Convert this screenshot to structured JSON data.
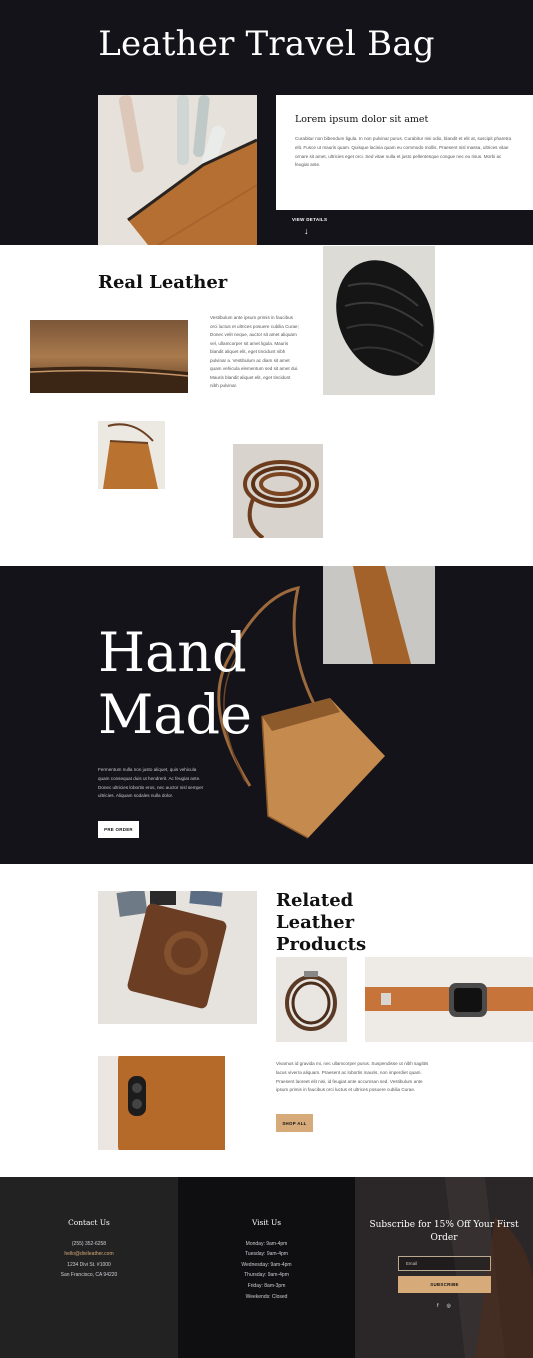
{
  "hero": {
    "title": "Leather Travel Bag",
    "card_heading": "Lorem ipsum dolor sit amet",
    "card_text": "Curabitur non bibendum ligula. In non pulvinar purus. Curabitur nisi odio, blandit et elit at, suscipit pharetra elit. Fusce ut mauris quam. Quisque lacinia quam eu commodo mollis. Praesent nisl massa, ultrices vitae ornare sit amet, ultricies eget orci. Sed vitae nulla et justo pellentesque congue nec eu risus. Morbi ac feugiat ante.",
    "view_details": "VIEW DETAILS",
    "arrow": "↓"
  },
  "real_leather": {
    "title": "Real Leather",
    "text": "Vestibulum ante ipsum primis in faucibus orci luctus et ultrices posuere cubilia Curae; Donec velit neque, auctor sit amet aliquam vel, ullamcorper sit amet ligula. Mauris blandit aliquet elit, eget tincidunt nibh pulvinar a. Vestibulum ac diam sit amet quam vehicula elementum sed sit amet dui. Mauris blandit aliquet elit, eget tincidunt nibh pulvinar."
  },
  "handmade": {
    "title_line1": "Hand",
    "title_line2": "Made",
    "text": "Fermentum nulla non justo aliquet, quis vehicula quam consequat duis ut hendrerit. Ac feugiat ante. Donec ultricies lobortis eros, nec auctor nisl semper ultricies. Aliquam sodales nulla dolor.",
    "button": "PRE ORDER"
  },
  "related": {
    "title": "Related Leather Products",
    "text": "Vivamus id gravida mi, nec ullamcorper purus. Suspendisse ut nibh sagittis lacus viverra aliquam. Praesent ac lobortis mauris, non imperdiet quam. Praesent laoreet elit nisi, id feugiat ante accumsan sed. Vestibulum ante ipsum primis in faucibus orci luctus et ultrices posuere cubilia Curae.",
    "button": "SHOP ALL"
  },
  "footer": {
    "contact": {
      "heading": "Contact Us",
      "phone": "(255) 352-6258",
      "email": "hello@diviIeather.com",
      "address1": "1234 Divi St. #1000",
      "address2": "San Francisco, CA 94220"
    },
    "visit": {
      "heading": "Visit Us",
      "hours": [
        "Monday: 9am-4pm",
        "Tuesday: 9am-4pm",
        "Wednesday: 9am-4pm",
        "Thursday: 9am-4pm",
        "Friday: 8am-3pm"
      ],
      "weekends": "Weekends: Closed"
    },
    "subscribe": {
      "title": "Subscribe for 15% Off Your First Order",
      "email_placeholder": "Email",
      "button": "SUBSCRIBE"
    },
    "social": {
      "facebook": "f",
      "instagram": "◎"
    }
  },
  "colors": {
    "dark": "#15131a",
    "accent": "#d6aa79",
    "leather": "#b5743a"
  }
}
